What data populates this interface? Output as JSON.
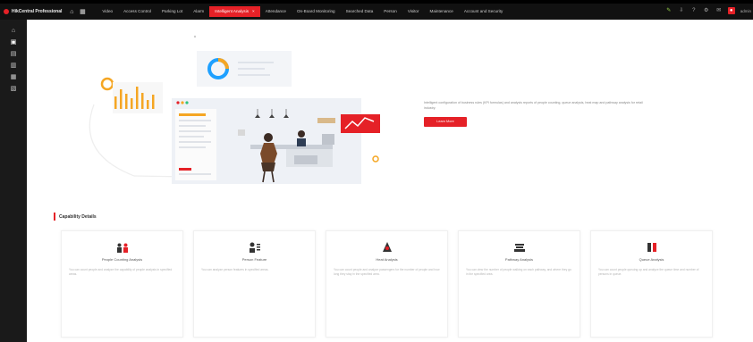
{
  "app": {
    "title": "HikCentral Professional"
  },
  "topbar": {
    "nav": [
      {
        "label": "Video",
        "active": false
      },
      {
        "label": "Access Control",
        "active": false
      },
      {
        "label": "Parking Lot",
        "active": false
      },
      {
        "label": "Alarm",
        "active": false
      },
      {
        "label": "Intelligent Analysis",
        "active": true
      },
      {
        "label": "Attendance",
        "active": false
      },
      {
        "label": "On-Board Monitoring",
        "active": false
      },
      {
        "label": "Searched Data",
        "active": false
      },
      {
        "label": "Person",
        "active": false
      },
      {
        "label": "Visitor",
        "active": false
      },
      {
        "label": "Maintenance",
        "active": false
      },
      {
        "label": "Account and Security",
        "active": false
      }
    ],
    "close_glyph": "×",
    "user": "admin"
  },
  "sidebar": {
    "items": [
      {
        "icon": "home-icon",
        "active": false
      },
      {
        "icon": "dashboard-icon",
        "active": true
      },
      {
        "icon": "report-icon",
        "active": false
      },
      {
        "icon": "analysis-icon",
        "active": false
      },
      {
        "icon": "people-icon",
        "active": false
      },
      {
        "icon": "settings-icon",
        "active": false
      }
    ]
  },
  "intro": {
    "text": "Intelligent configuration of business rules (KPI formulas) and analysis reports of people counting, queue analysis, heat map and pathway analysis for retail industry.",
    "button": "Learn More"
  },
  "capability": {
    "title": "Capability Details",
    "cards": [
      {
        "title": "People Counting Analysis",
        "desc": "You can count people and analyze the capability of people analysis in specified areas.",
        "icon": "people-counting-icon"
      },
      {
        "title": "Person Feature",
        "desc": "You can analyze person features in specified areas.",
        "icon": "person-feature-icon"
      },
      {
        "title": "Heat Analysis",
        "desc": "You can count people and analyze passengers for the number of people and how long they stay in the specified area.",
        "icon": "heat-analysis-icon"
      },
      {
        "title": "Pathway Analysis",
        "desc": "You can view the number of people walking on each pathway, and where they go in the specified area.",
        "icon": "pathway-analysis-icon"
      },
      {
        "title": "Queue Analysis",
        "desc": "You can count people queuing up and analyze the queue time and number of persons in queue.",
        "icon": "queue-analysis-icon"
      }
    ]
  },
  "colors": {
    "accent": "#e52127",
    "topbar": "#111111",
    "sidebar": "#1a1a1a"
  }
}
